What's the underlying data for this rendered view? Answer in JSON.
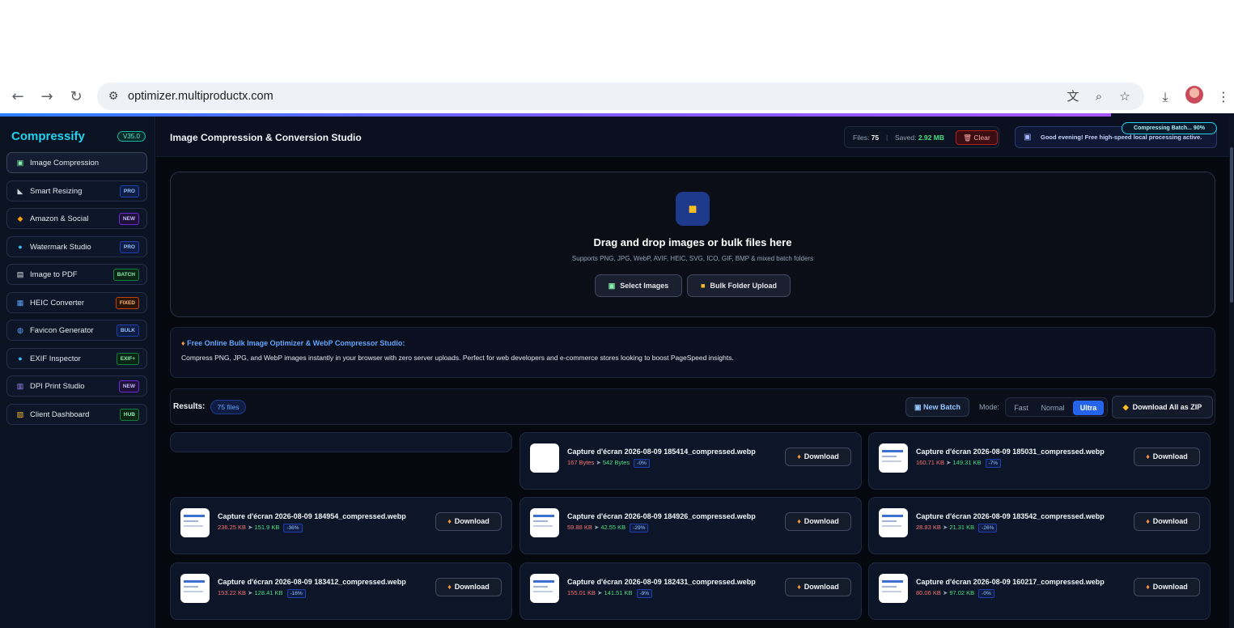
{
  "browser": {
    "url": "optimizer.multiproductx.com"
  },
  "sidebar": {
    "brand": "Compressify",
    "version": "V35.0",
    "items": [
      {
        "label": "Image Compression",
        "icon": "image-icon",
        "badge": ""
      },
      {
        "label": "Smart Resizing",
        "icon": "resize-icon",
        "badge": "PRO"
      },
      {
        "label": "Amazon & Social",
        "icon": "box-icon",
        "badge": "NEW"
      },
      {
        "label": "Watermark Studio",
        "icon": "droplet-icon",
        "badge": "PRO"
      },
      {
        "label": "Image to PDF",
        "icon": "document-icon",
        "badge": "BATCH"
      },
      {
        "label": "HEIC Converter",
        "icon": "convert-icon",
        "badge": "FIXED"
      },
      {
        "label": "Favicon Generator",
        "icon": "globe-icon",
        "badge": "BULK"
      },
      {
        "label": "EXIF Inspector",
        "icon": "magnifier-icon",
        "badge": "EXIF+"
      },
      {
        "label": "DPI Print Studio",
        "icon": "printer-icon",
        "badge": "NEW"
      },
      {
        "label": "Client Dashboard",
        "icon": "chart-icon",
        "badge": "HUB"
      }
    ]
  },
  "header": {
    "title": "Image Compression & Conversion Studio",
    "files_label": "Files:",
    "files_count": "75",
    "saved_label": "Saved:",
    "saved_value": "2.92 MB",
    "clear_label": "Clear",
    "greeting": "Good evening! Free high-speed local processing active.",
    "toast": "Compressing Batch... 90%"
  },
  "progress": {
    "percent": 90
  },
  "dropzone": {
    "title": "Drag and drop images or bulk files here",
    "subtitle": "Supports PNG, JPG, WebP, AVIF, HEIC, SVG, ICO, GIF, BMP & mixed batch folders",
    "select_label": "Select Images",
    "folder_label": "Bulk Folder Upload"
  },
  "info": {
    "title": "Free Online Bulk Image Optimizer & WebP Compressor Studio:",
    "text": "Compress PNG, JPG, and WebP images instantly in your browser with zero server uploads. Perfect for web developers and e-commerce stores looking to boost PageSpeed insights."
  },
  "results": {
    "label": "Results:",
    "count": "75 files",
    "new_batch": "New Batch",
    "mode_label": "Mode:",
    "modes": [
      "Fast",
      "Normal",
      "Ultra"
    ],
    "active_mode": "Ultra",
    "zip_label": "Download All as ZIP",
    "download_label": "Download",
    "files": [
      {
        "name": "Capture d'écran 2026-08-09 185414_compressed.webp",
        "orig": "167 Bytes",
        "new": "542 Bytes",
        "pct": "-0%",
        "thumb": "blank"
      },
      {
        "name": "Capture d'écran 2026-08-09 185031_compressed.webp",
        "orig": "160.71 KB",
        "new": "149.31 KB",
        "pct": "-7%",
        "thumb": "doc"
      },
      {
        "name": "Capture d'écran 2026-08-09 184954_compressed.webp",
        "orig": "236.25 KB",
        "new": "151.9 KB",
        "pct": "-36%",
        "thumb": "doc"
      },
      {
        "name": "Capture d'écran 2026-08-09 184926_compressed.webp",
        "orig": "59.88 KB",
        "new": "42.55 KB",
        "pct": "-29%",
        "thumb": "doc"
      },
      {
        "name": "Capture d'écran 2026-08-09 183542_compressed.webp",
        "orig": "28.83 KB",
        "new": "21.31 KB",
        "pct": "-26%",
        "thumb": "doc"
      },
      {
        "name": "Capture d'écran 2026-08-09 183412_compressed.webp",
        "orig": "153.22 KB",
        "new": "128.41 KB",
        "pct": "-16%",
        "thumb": "doc"
      },
      {
        "name": "Capture d'écran 2026-08-09 182431_compressed.webp",
        "orig": "155.01 KB",
        "new": "141.51 KB",
        "pct": "-9%",
        "thumb": "doc"
      },
      {
        "name": "Capture d'écran 2026-08-09 160217_compressed.webp",
        "orig": "80.06 KB",
        "new": "97.02 KB",
        "pct": "-0%",
        "thumb": "doc"
      }
    ]
  },
  "colors": {
    "brand": "#22d3ee",
    "accent": "#2563eb",
    "saved": "#4ade80",
    "orig_size": "#f87171"
  }
}
